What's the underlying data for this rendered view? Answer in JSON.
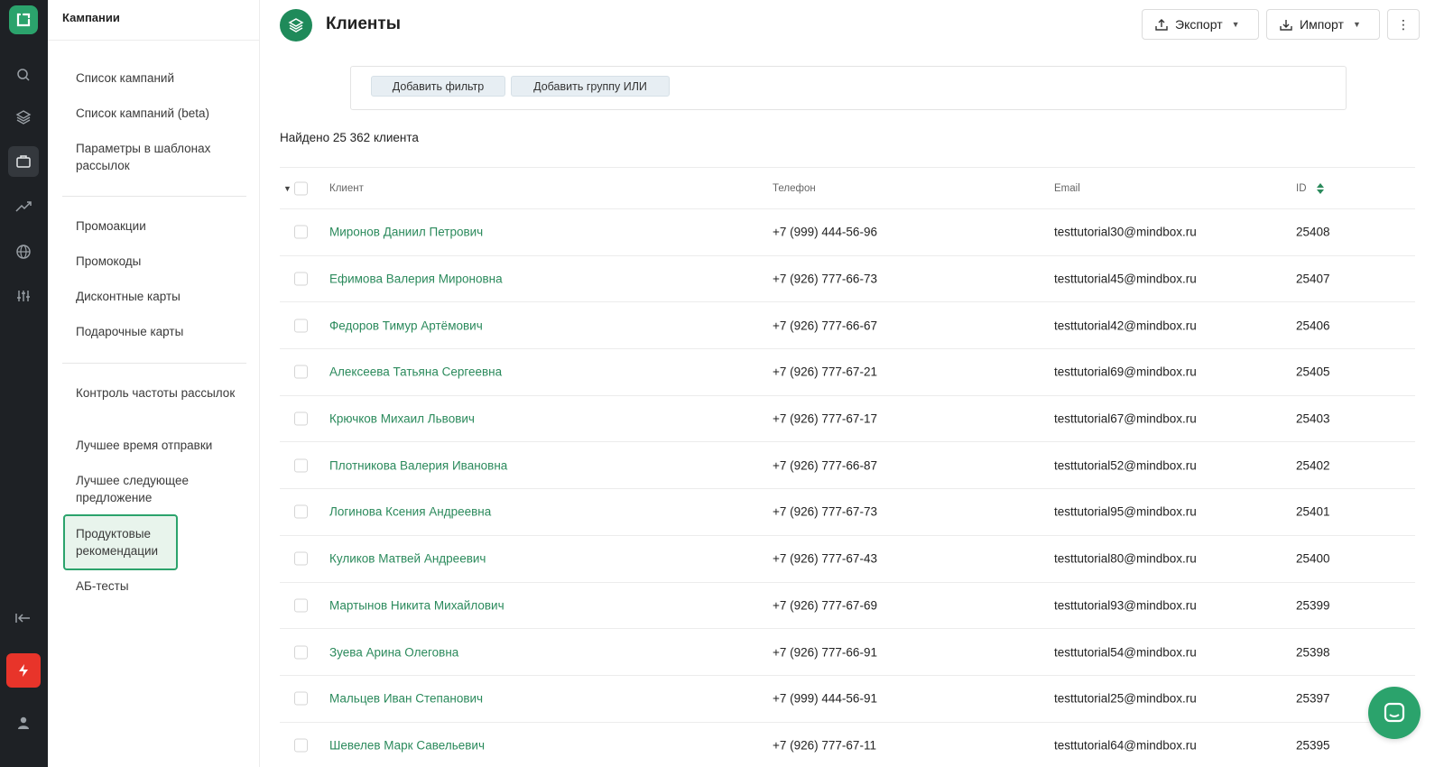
{
  "colors": {
    "accent": "#2ba36c",
    "rail_bg": "#1e2125",
    "link": "#2b8a5c",
    "alert": "#e8342a"
  },
  "rail": {
    "icons": [
      "logo-icon",
      "search-icon",
      "layers-icon",
      "briefcase-icon",
      "trend-icon",
      "globe-icon",
      "sliders-icon",
      "collapse-icon",
      "bolt-icon",
      "user-icon"
    ]
  },
  "subnav": {
    "title": "Кампании",
    "items": [
      "Список кампаний",
      "Список кампаний (beta)",
      "Параметры в шаблонах рассылок",
      "Промоакции",
      "Промокоды",
      "Дисконтные карты",
      "Подарочные карты",
      "Контроль частоты рассылок",
      "Лучшее время отправки",
      "Лучшее следующее предложение",
      "Продуктовые рекомендации",
      "АБ-тесты"
    ],
    "active_item": "Продуктовые рекомендации"
  },
  "header": {
    "title": "Клиенты",
    "export_label": "Экспорт",
    "import_label": "Импорт",
    "more_label": "⋮"
  },
  "filters": {
    "add_filter": "Добавить фильтр",
    "add_or_group": "Добавить группу ИЛИ"
  },
  "summary": "Найдено 25 362 клиента",
  "table": {
    "columns": [
      "Клиент",
      "Телефон",
      "Email",
      "ID"
    ],
    "rows": [
      {
        "name": "Миронов Даниил Петрович",
        "phone": "+7 (999) 444-56-96",
        "email": "testtutorial30@mindbox.ru",
        "id": "25408"
      },
      {
        "name": "Ефимова Валерия Мироновна",
        "phone": "+7 (926) 777-66-73",
        "email": "testtutorial45@mindbox.ru",
        "id": "25407"
      },
      {
        "name": "Федоров Тимур Артёмович",
        "phone": "+7 (926) 777-66-67",
        "email": "testtutorial42@mindbox.ru",
        "id": "25406"
      },
      {
        "name": "Алексеева Татьяна Сергеевна",
        "phone": "+7 (926) 777-67-21",
        "email": "testtutorial69@mindbox.ru",
        "id": "25405"
      },
      {
        "name": "Крючков Михаил Львович",
        "phone": "+7 (926) 777-67-17",
        "email": "testtutorial67@mindbox.ru",
        "id": "25403"
      },
      {
        "name": "Плотникова Валерия Ивановна",
        "phone": "+7 (926) 777-66-87",
        "email": "testtutorial52@mindbox.ru",
        "id": "25402"
      },
      {
        "name": "Логинова Ксения Андреевна",
        "phone": "+7 (926) 777-67-73",
        "email": "testtutorial95@mindbox.ru",
        "id": "25401"
      },
      {
        "name": "Куликов Матвей Андреевич",
        "phone": "+7 (926) 777-67-43",
        "email": "testtutorial80@mindbox.ru",
        "id": "25400"
      },
      {
        "name": "Мартынов Никита Михайлович",
        "phone": "+7 (926) 777-67-69",
        "email": "testtutorial93@mindbox.ru",
        "id": "25399"
      },
      {
        "name": "Зуева Арина Олеговна",
        "phone": "+7 (926) 777-66-91",
        "email": "testtutorial54@mindbox.ru",
        "id": "25398"
      },
      {
        "name": "Мальцев Иван Степанович",
        "phone": "+7 (999) 444-56-91",
        "email": "testtutorial25@mindbox.ru",
        "id": "25397"
      },
      {
        "name": "Шевелев Марк Савельевич",
        "phone": "+7 (926) 777-67-11",
        "email": "testtutorial64@mindbox.ru",
        "id": "25395"
      }
    ]
  }
}
